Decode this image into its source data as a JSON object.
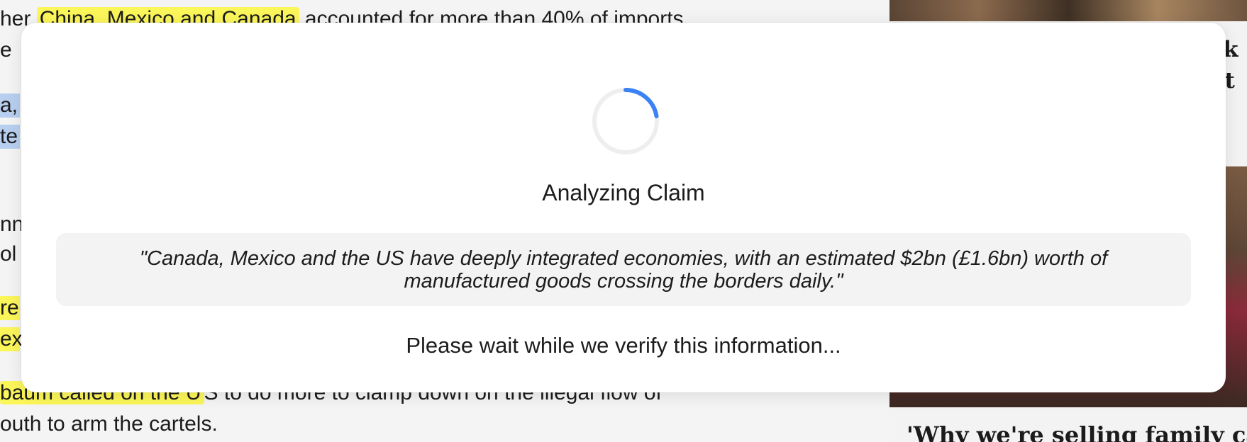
{
  "article": {
    "line1_prefix": "her ",
    "line1_highlight": "China, Mexico and Canada",
    "line1_suffix": " accounted for more than 40% of imports",
    "line2_prefix": "e ",
    "line3_start": "a,",
    "line4_start": "te",
    "line5_start": "nn",
    "line6_start": "ol",
    "line7_start": "re",
    "line8_start": "exi",
    "line9_highlight": "baum called on the U",
    "line9_suffix": "S to do more to clamp down on the illegal flow of",
    "line10": "outh to arm the cartels."
  },
  "sidebar": {
    "card_headline_line1": "ak",
    "card_headline_line2": "nt",
    "bottom_headline": "'Why we're selling family ca"
  },
  "modal": {
    "title": "Analyzing Claim",
    "claim": "\"Canada, Mexico and the US have deeply integrated economies, with an estimated $2bn (£1.6bn) worth of manufactured goods crossing the borders daily.\"",
    "status": "Please wait while we verify this information..."
  },
  "colors": {
    "spinner_accent": "#3b82f6",
    "spinner_track": "#eeeeee",
    "highlight_yellow": "#fbf65a",
    "highlight_blue": "#b8cff0"
  }
}
